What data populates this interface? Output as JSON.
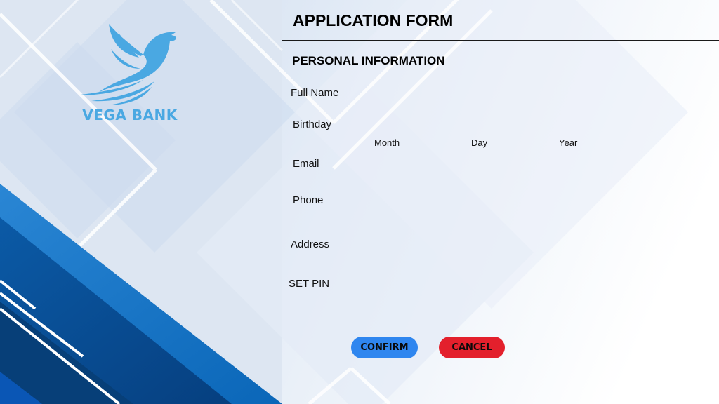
{
  "brand": {
    "name": "VEGA BANK",
    "logo_icon": "dove-icon",
    "logo_color": "#4aa8e2"
  },
  "form": {
    "title": "APPLICATION FORM",
    "section_title": "PERSONAL INFORMATION",
    "fields": {
      "full_name": "Full Name",
      "birthday": "Birthday",
      "birthday_month": "Month",
      "birthday_day": "Day",
      "birthday_year": "Year",
      "email": "Email",
      "phone": "Phone",
      "address": "Address",
      "pin": "SET PIN"
    }
  },
  "actions": {
    "confirm_label": "CONFIRM",
    "confirm_color": "#2f86ef",
    "cancel_label": "CANCEL",
    "cancel_color": "#e3202c"
  }
}
